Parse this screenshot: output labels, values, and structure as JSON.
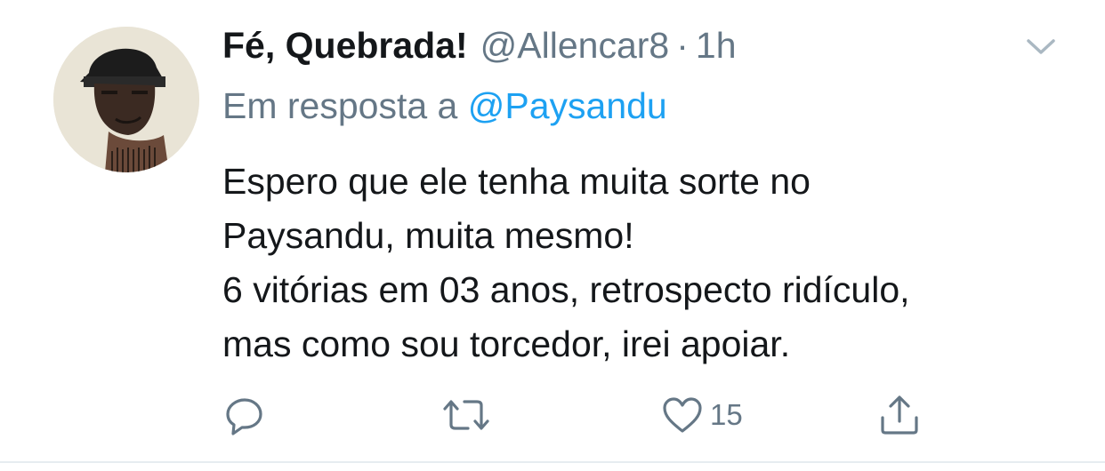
{
  "tweet": {
    "display_name": "Fé, Quebrada!",
    "handle": "@Allencar8",
    "separator": "·",
    "time": "1h",
    "reply_prefix": "Em resposta a",
    "reply_mention": "@Paysandu",
    "text_lines": [
      "Espero que ele tenha muita sorte no",
      "Paysandu, muita mesmo!",
      "6 vitórias em 03 anos, retrospecto ridículo,",
      "mas como sou torcedor, irei apoiar."
    ],
    "like_count": "15"
  },
  "icons": {
    "caret": "chevron-down-icon",
    "reply": "reply-icon",
    "retweet": "retweet-icon",
    "like": "heart-icon",
    "share": "share-icon"
  },
  "colors": {
    "text": "#14171a",
    "muted": "#657786",
    "link": "#1da1f2",
    "divider": "#e6ecf0",
    "icon_light": "#aab8c2"
  }
}
